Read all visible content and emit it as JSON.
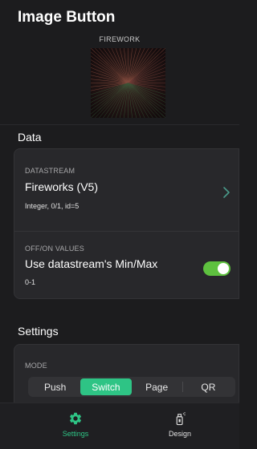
{
  "page": {
    "title": "Image Button"
  },
  "preview": {
    "label": "FIREWORK"
  },
  "data_section": {
    "title": "Data",
    "datastream": {
      "caption": "DATASTREAM",
      "name": "Fireworks (V5)",
      "details": "Integer, 0/1, id=5"
    },
    "values": {
      "caption": "OFF/ON VALUES",
      "label": "Use datastream's Min/Max",
      "range": "0-1",
      "toggle_on": true
    }
  },
  "settings_section": {
    "title": "Settings",
    "mode": {
      "caption": "MODE",
      "options": [
        "Push",
        "Switch",
        "Page",
        "QR"
      ],
      "selected": "Switch"
    }
  },
  "nav": {
    "items": [
      {
        "label": "Settings",
        "icon": "gear-icon",
        "active": true
      },
      {
        "label": "Design",
        "icon": "spray-can-icon",
        "active": false
      }
    ]
  },
  "colors": {
    "background": "#1c1c1e",
    "card": "#28282b",
    "accent": "#2ec485",
    "toggle": "#5ec13f",
    "muted": "#a8a8aa"
  }
}
